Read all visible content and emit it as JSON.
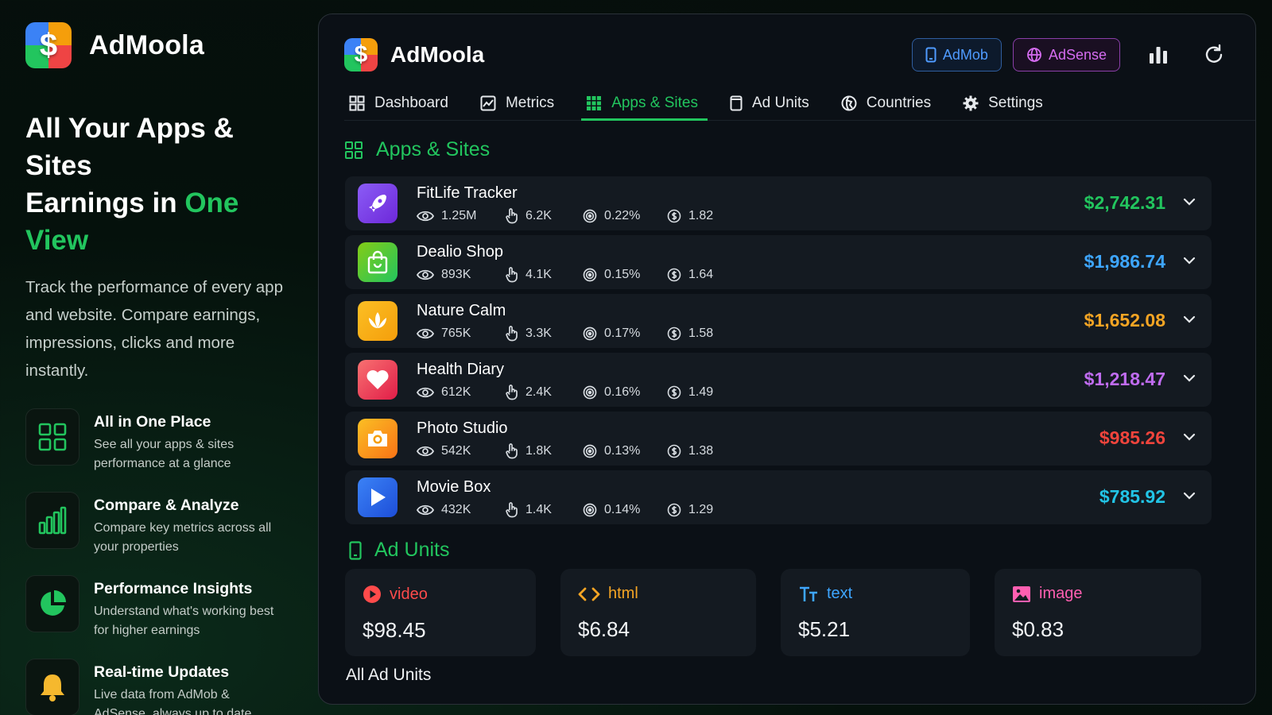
{
  "brand": {
    "name": "AdMoola",
    "logo_glyph": "$"
  },
  "hero": {
    "headline_line1": "All Your Apps & Sites",
    "headline_line2_prefix": "Earnings in ",
    "headline_accent": "One View",
    "tagline": "Track the performance of every app and website. Compare earnings, impressions, clicks and more instantly."
  },
  "features": [
    {
      "title": "All in One Place",
      "desc": "See all your apps & sites performance at a glance",
      "icon": "grid-icon"
    },
    {
      "title": "Compare & Analyze",
      "desc": "Compare key metrics across all your properties",
      "icon": "bar-chart-icon"
    },
    {
      "title": "Performance Insights",
      "desc": "Understand what's working best for higher earnings",
      "icon": "pie-chart-icon"
    },
    {
      "title": "Real-time Updates",
      "desc": "Live data from AdMob & AdSense, always up to date",
      "icon": "bell-icon"
    }
  ],
  "window": {
    "title": "AdMoola",
    "sources": {
      "admob": "AdMob",
      "adsense": "AdSense"
    },
    "tabs": [
      {
        "label": "Dashboard",
        "icon": "dashboard-icon"
      },
      {
        "label": "Metrics",
        "icon": "metrics-icon"
      },
      {
        "label": "Apps & Sites",
        "icon": "apps-grid-icon",
        "active": true
      },
      {
        "label": "Ad Units",
        "icon": "phone-icon"
      },
      {
        "label": "Countries",
        "icon": "globe-icon"
      },
      {
        "label": "Settings",
        "icon": "gear-icon"
      }
    ]
  },
  "apps_section": {
    "title": "Apps & Sites",
    "apps": [
      {
        "name": "FitLife Tracker",
        "impressions": "1.25M",
        "clicks": "6.2K",
        "ctr": "0.22%",
        "ecpm": "1.82",
        "earnings": "$2,742.31",
        "color": "#22c55e",
        "icon": "rocket-icon"
      },
      {
        "name": "Dealio Shop",
        "impressions": "893K",
        "clicks": "4.1K",
        "ctr": "0.15%",
        "ecpm": "1.64",
        "earnings": "$1,986.74",
        "color": "#3ea6ff",
        "icon": "shopping-bag-icon"
      },
      {
        "name": "Nature Calm",
        "impressions": "765K",
        "clicks": "3.3K",
        "ctr": "0.17%",
        "ecpm": "1.58",
        "earnings": "$1,652.08",
        "color": "#f5a524",
        "icon": "lotus-icon"
      },
      {
        "name": "Health Diary",
        "impressions": "612K",
        "clicks": "2.4K",
        "ctr": "0.16%",
        "ecpm": "1.49",
        "earnings": "$1,218.47",
        "color": "#c06cf0",
        "icon": "heart-icon"
      },
      {
        "name": "Photo Studio",
        "impressions": "542K",
        "clicks": "1.8K",
        "ctr": "0.13%",
        "ecpm": "1.38",
        "earnings": "$985.26",
        "color": "#f0443c",
        "icon": "camera-icon"
      },
      {
        "name": "Movie Box",
        "impressions": "432K",
        "clicks": "1.4K",
        "ctr": "0.14%",
        "ecpm": "1.29",
        "earnings": "$785.92",
        "color": "#22c4e6",
        "icon": "play-icon"
      }
    ]
  },
  "ad_units_section": {
    "title": "Ad Units",
    "units": [
      {
        "type": "video",
        "value": "$98.45",
        "color": "#ff4b4b",
        "icon": "video-play-icon"
      },
      {
        "type": "html",
        "value": "$6.84",
        "color": "#f5a524",
        "icon": "code-icon"
      },
      {
        "type": "text",
        "value": "$5.21",
        "color": "#3ea6ff",
        "icon": "text-size-icon"
      },
      {
        "type": "image",
        "value": "$0.83",
        "color": "#ff5fb1",
        "icon": "image-icon"
      }
    ],
    "all_units_label": "All Ad Units"
  }
}
